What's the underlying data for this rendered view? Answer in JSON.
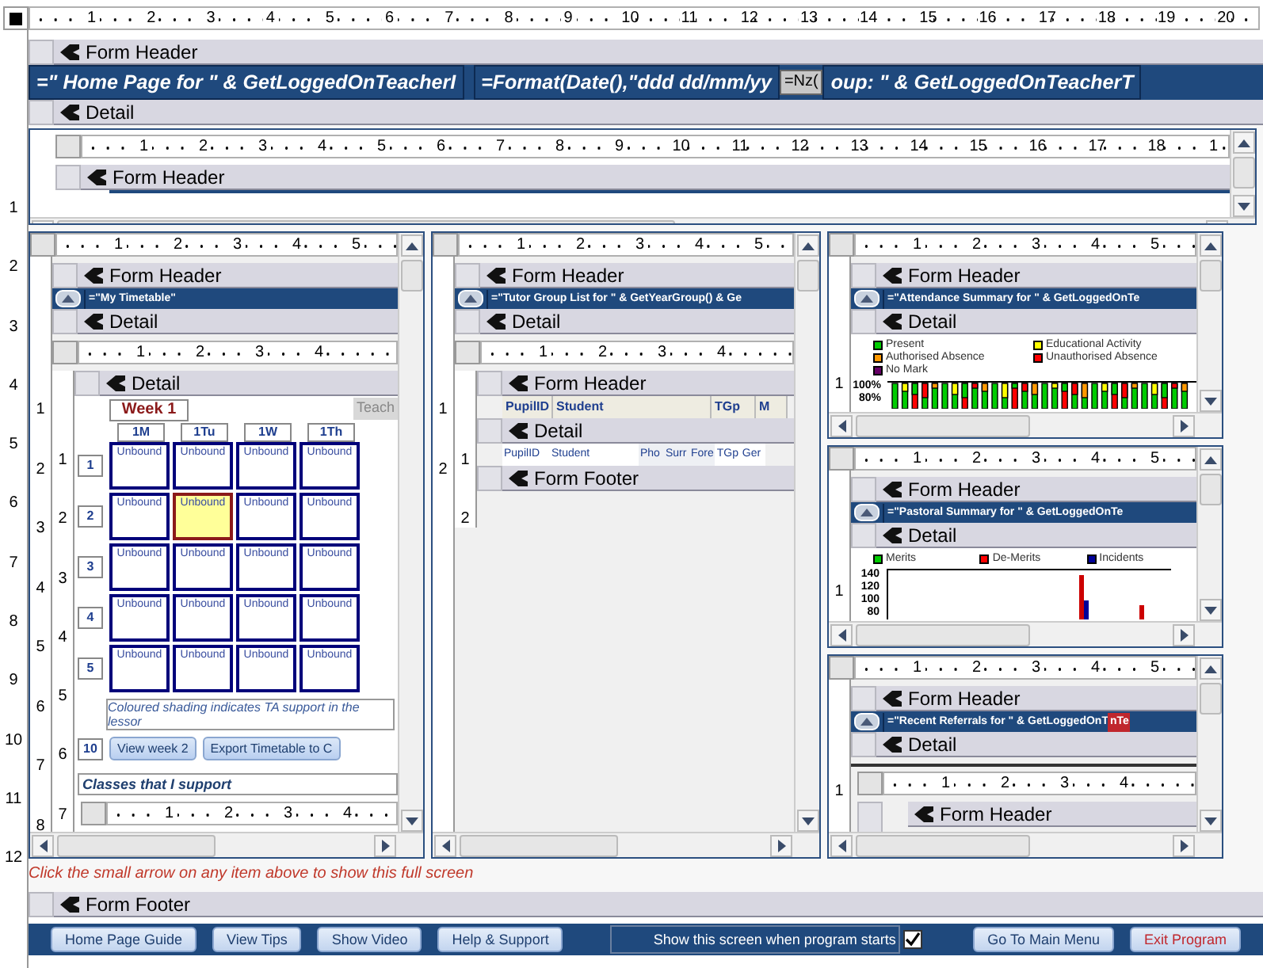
{
  "ruler": [
    "1",
    "2",
    "3",
    "4",
    "5",
    "6",
    "7",
    "8",
    "9",
    "10",
    "11",
    "12",
    "13",
    "14",
    "15",
    "16",
    "17",
    "18",
    "19",
    "20"
  ],
  "vertical_ruler": [
    "1",
    "2",
    "3",
    "4",
    "5",
    "6",
    "7",
    "8",
    "9",
    "10",
    "11",
    "12"
  ],
  "form_header": {
    "label": "Form Header",
    "fields": [
      {
        "kind": "expr",
        "text": "=\" Home Page for \" & GetLoggedOnTeacherI"
      },
      {
        "kind": "expr",
        "text": "=Format(Date(),\"ddd dd/mm/yy"
      },
      {
        "kind": "tag",
        "text": "=Nz("
      },
      {
        "kind": "expr",
        "text": "oup: \" & GetLoggedOnTeacherT"
      }
    ]
  },
  "detail": {
    "label": "Detail"
  },
  "top_subform": {
    "ruler": [
      "1",
      "2",
      "3",
      "4",
      "5",
      "6",
      "7",
      "8",
      "9",
      "10",
      "11",
      "12",
      "13",
      "14",
      "15",
      "16",
      "17",
      "18",
      "1"
    ],
    "header_label": "Form Header"
  },
  "timetable_subform": {
    "ruler": [
      "1",
      "2",
      "3",
      "4",
      "5"
    ],
    "vertical_ruler": [
      "1",
      "2",
      "3",
      "4",
      "5",
      "6",
      "7",
      "8"
    ],
    "header": {
      "label": "Form Header",
      "expression": "=\"My Timetable\""
    },
    "detail_label": "Detail",
    "inner": {
      "ruler": [
        "1",
        "2",
        "3",
        "4"
      ],
      "vertical_ruler": [
        "1",
        "2",
        "3",
        "4",
        "5",
        "6",
        "7"
      ],
      "detail_label": "Detail",
      "week": "Week 1",
      "tab": "Teach",
      "days": [
        "1M",
        "1Tu",
        "1W",
        "1Th"
      ],
      "periods": [
        {
          "label": "1",
          "cells": [
            {
              "text": "Unbound",
              "highlighted": false
            },
            {
              "text": "Unbound",
              "highlighted": false
            },
            {
              "text": "Unbound",
              "highlighted": false
            },
            {
              "text": "Unbound",
              "highlighted": false
            }
          ]
        },
        {
          "label": "2",
          "cells": [
            {
              "text": "Unbound",
              "highlighted": false
            },
            {
              "text": "Unbound",
              "highlighted": true
            },
            {
              "text": "Unbound",
              "highlighted": false
            },
            {
              "text": "Unbound",
              "highlighted": false
            }
          ]
        },
        {
          "label": "3",
          "cells": [
            {
              "text": "Unbound",
              "highlighted": false
            },
            {
              "text": "Unbound",
              "highlighted": false
            },
            {
              "text": "Unbound",
              "highlighted": false
            },
            {
              "text": "Unbound",
              "highlighted": false
            }
          ]
        },
        {
          "label": "4",
          "cells": [
            {
              "text": "Unbound",
              "highlighted": false
            },
            {
              "text": "Unbound",
              "highlighted": false
            },
            {
              "text": "Unbound",
              "highlighted": false
            },
            {
              "text": "Unbound",
              "highlighted": false
            }
          ]
        },
        {
          "label": "5",
          "cells": [
            {
              "text": "Unbound",
              "highlighted": false
            },
            {
              "text": "Unbound",
              "highlighted": false
            },
            {
              "text": "Unbound",
              "highlighted": false
            },
            {
              "text": "Unbound",
              "highlighted": false
            }
          ]
        }
      ],
      "note": "Coloured shading indicates TA support in the lessor",
      "extra_label": "10",
      "buttons": [
        "View week 2",
        "Export Timetable to C"
      ],
      "classes_label": "Classes that I support",
      "nested_ruler": [
        "1",
        "2",
        "3",
        "4"
      ]
    }
  },
  "tutor_subform": {
    "ruler": [
      "1",
      "2",
      "3",
      "4",
      "5"
    ],
    "vertical_ruler": [
      "1",
      "2"
    ],
    "header": {
      "label": "Form Header",
      "expression": "=\"Tutor Group List for \" & GetYearGroup() & Ge"
    },
    "detail_label": "Detail",
    "inner": {
      "ruler": [
        "1",
        "2",
        "3",
        "4"
      ],
      "vertical_ruler": [
        "1",
        "2"
      ],
      "header_label": "Form Header",
      "header_cells": [
        "PupilID",
        "Student",
        "TGp",
        "M"
      ],
      "detail_label": "Detail",
      "detail_cells": [
        "PupilID",
        "Student",
        "Pho",
        "Surr",
        "Fore",
        "TGp",
        "Ger"
      ],
      "footer_label": "Form Footer"
    }
  },
  "attendance_subform": {
    "ruler": [
      "1",
      "2",
      "3",
      "4",
      "5"
    ],
    "vertical_ruler": [
      "1"
    ],
    "header": {
      "label": "Form Header",
      "expression": "=\"Attendance Summary for \" & GetLoggedOnTe"
    },
    "detail_label": "Detail",
    "legend": [
      {
        "label": "Present",
        "color": "#00cc00"
      },
      {
        "label": "Educational Activity",
        "color": "#ffff00"
      },
      {
        "label": "Authorised Absence",
        "color": "#ff9900"
      },
      {
        "label": "Unauthorised Absence",
        "color": "#ff0000"
      },
      {
        "label": "No Mark",
        "color": "#660066"
      }
    ],
    "yticks": [
      "100%",
      "80%"
    ]
  },
  "pastoral_subform": {
    "ruler": [
      "1",
      "2",
      "3",
      "4",
      "5"
    ],
    "vertical_ruler": [
      "1"
    ],
    "header": {
      "label": "Form Header",
      "expression": "=\"Pastoral Summary for \" & GetLoggedOnTe"
    },
    "detail_label": "Detail",
    "legend": [
      {
        "label": "Merits",
        "color": "#00cc00"
      },
      {
        "label": "De-Merits",
        "color": "#ff0000"
      },
      {
        "label": "Incidents",
        "color": "#000099"
      }
    ],
    "yticks": [
      "140",
      "120",
      "100",
      "80"
    ]
  },
  "referrals_subform": {
    "ruler": [
      "1",
      "2",
      "3",
      "4",
      "5"
    ],
    "vertical_ruler": [
      "1"
    ],
    "header": {
      "label": "Form Header",
      "expression": "=\"Recent Referrals for \" & GetLoggedOnT",
      "flag": "nTe"
    },
    "detail_label": "Detail",
    "inner": {
      "ruler": [
        "1",
        "2",
        "3",
        "4"
      ],
      "header_label": "Form Header"
    }
  },
  "note": "Click the small arrow on any item above to show this full screen",
  "form_footer": {
    "label": "Form Footer",
    "items": [
      {
        "kind": "button",
        "label": "Home Page Guide"
      },
      {
        "kind": "button",
        "label": "View Tips"
      },
      {
        "kind": "button",
        "label": "Show Video"
      },
      {
        "kind": "button",
        "label": "Help & Support"
      },
      {
        "kind": "checkbox",
        "label": "Show this screen when program starts",
        "checked": true
      },
      {
        "kind": "button",
        "label": "Go To Main Menu"
      },
      {
        "kind": "exit",
        "label": "Exit Program"
      }
    ]
  }
}
